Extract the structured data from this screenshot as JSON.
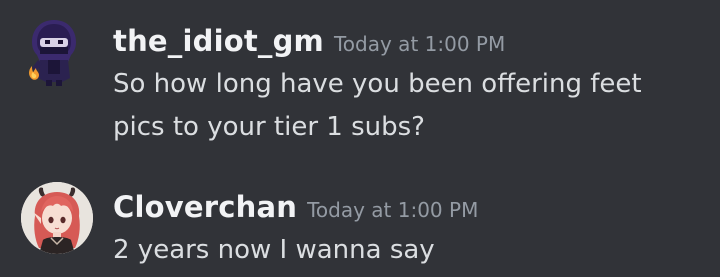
{
  "messages": [
    {
      "username": "the_idiot_gm",
      "timestamp": "Today at 1:00 PM",
      "text": "So how long have you been offering feet pics to your tier 1 subs?",
      "avatar": "ninja-avatar-icon"
    },
    {
      "username": "Cloverchan",
      "timestamp": "Today at 1:00 PM",
      "text": "2 years now I wanna say",
      "avatar": "anime-girl-avatar-icon"
    }
  ],
  "colors": {
    "background": "#313338",
    "username": "#f2f3f5",
    "timestamp": "#949ba4",
    "message_text": "#dbdee1"
  }
}
